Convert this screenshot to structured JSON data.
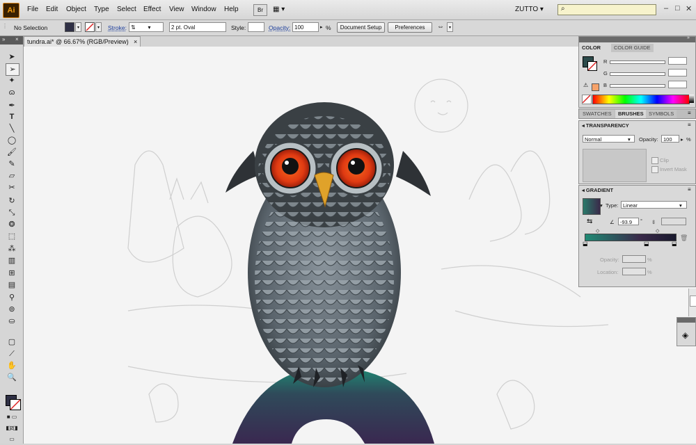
{
  "app": {
    "logo": "Ai"
  },
  "menu": [
    "File",
    "Edit",
    "Object",
    "Type",
    "Select",
    "Effect",
    "View",
    "Window",
    "Help"
  ],
  "bridge_label": "Br",
  "workspace": {
    "name": "ZUTTO ▾"
  },
  "controlbar": {
    "selection": "No Selection",
    "stroke_label": "Stroke:",
    "brush": "2 pt. Oval",
    "style_label": "Style:",
    "opacity_label": "Opacity:",
    "opacity_value": "100",
    "percent": "%",
    "doc_setup": "Document Setup",
    "preferences": "Preferences",
    "fill_color": "#2f3045",
    "stroke_color": "#c0392b"
  },
  "document": {
    "tab_title": "tundra.ai* @ 66.67% (RGB/Preview)",
    "close": "×"
  },
  "color_panel": {
    "tabs": [
      "COLOR",
      "COLOR GUIDE"
    ],
    "channels": [
      "R",
      "G",
      "B"
    ],
    "fg_color": "#2c4a4a",
    "warning_color": "#f6a26a"
  },
  "swatch_tabs": [
    "SWATCHES",
    "BRUSHES",
    "SYMBOLS"
  ],
  "transparency_panel": {
    "title": "TRANSPARENCY",
    "blend_mode": "Normal",
    "opacity_label": "Opacity:",
    "opacity_value": "100",
    "percent": "%",
    "clip": "Clip",
    "invert_mask": "Invert Mask"
  },
  "gradient_panel": {
    "title": "GRADIENT",
    "type_label": "Type:",
    "type_value": "Linear",
    "angle": "-93.9",
    "degree": "°",
    "opacity_label": "Opacity:",
    "location_label": "Location:",
    "percent": "%",
    "stops": [
      "#2a7a6a",
      "#3a2a4a",
      "#1a1a2e"
    ]
  },
  "icons": [
    "selection-icon",
    "direct-selection-icon",
    "magic-wand-icon",
    "lasso-icon",
    "pen-icon",
    "type-icon",
    "line-icon",
    "ellipse-icon",
    "paintbrush-icon",
    "pencil-icon",
    "eraser-icon",
    "scissors-icon",
    "rotate-icon",
    "scale-icon",
    "warp-icon",
    "free-transform-icon",
    "symbol-sprayer-icon",
    "graph-icon",
    "mesh-icon",
    "gradient-icon",
    "eyedropper-icon",
    "blend-icon",
    "live-paint-icon",
    "artboard-icon",
    "slice-icon",
    "hand-icon",
    "zoom-icon"
  ]
}
